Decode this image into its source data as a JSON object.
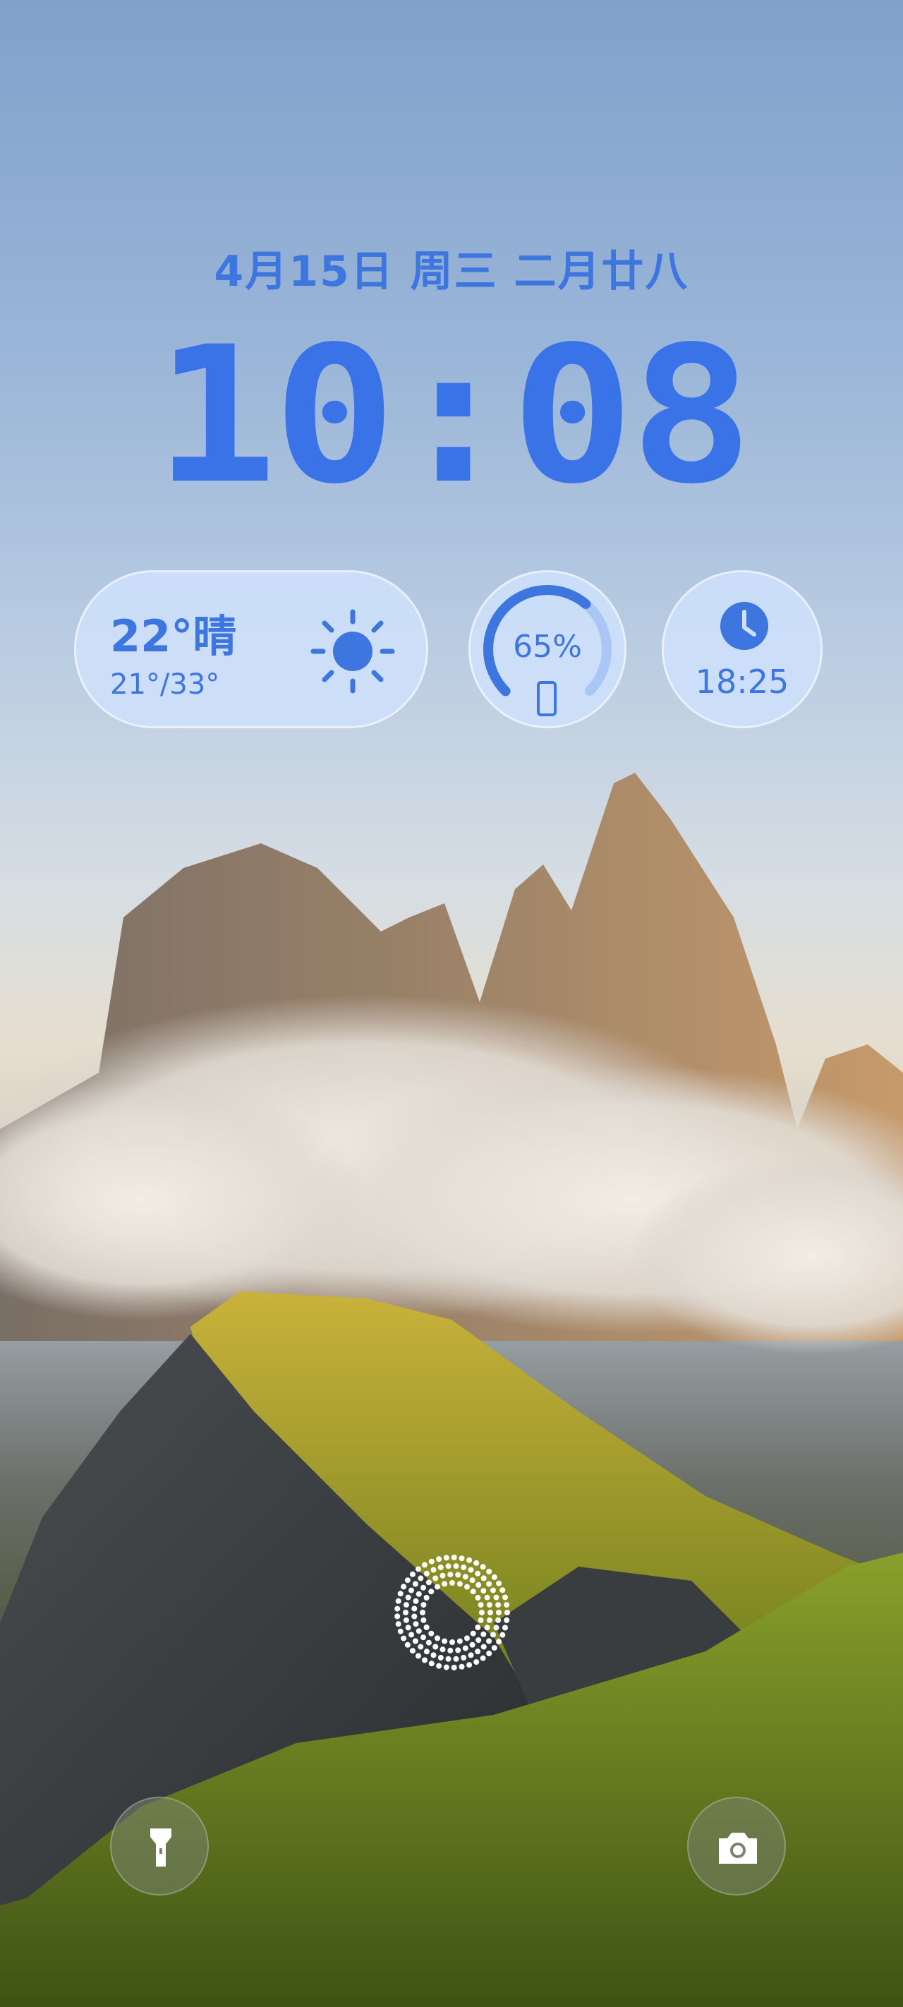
{
  "lockscreen": {
    "date_line": "4月15日 周三 二月廿八",
    "time": "10:08"
  },
  "widgets": {
    "weather": {
      "current": "22°晴",
      "range": "21°/33°",
      "icon": "sun-icon"
    },
    "battery": {
      "percent_label": "65%",
      "level": 0.65,
      "icon": "phone-icon"
    },
    "alarm": {
      "time": "18:25",
      "icon": "clock-icon"
    }
  },
  "shortcuts": {
    "left_icon": "flashlight-icon",
    "right_icon": "camera-icon"
  },
  "fingerprint_icon": "fingerprint-icon",
  "colors": {
    "accent": "#3e76e0",
    "widget_bg": "#cee0fa"
  }
}
